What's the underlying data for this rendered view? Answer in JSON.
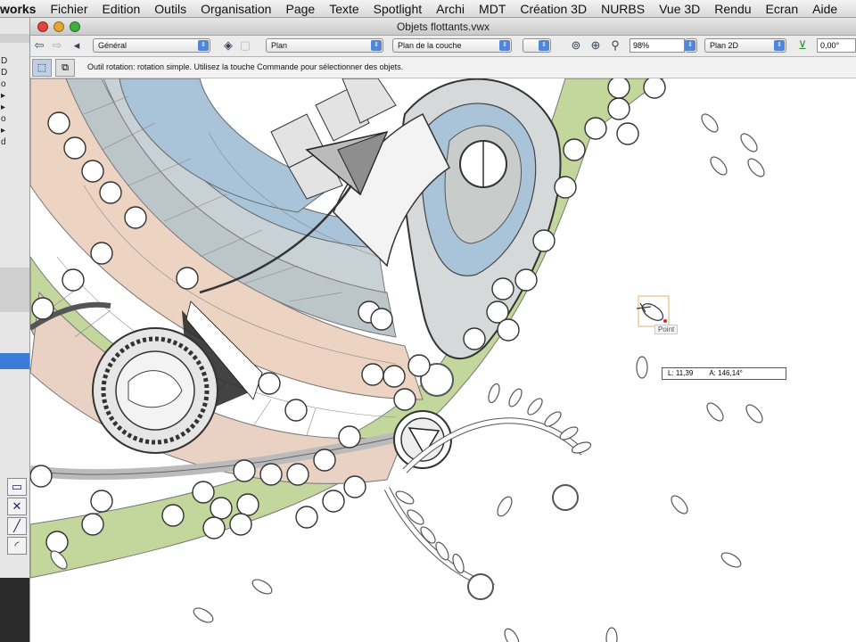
{
  "menubar": {
    "app_name": "works",
    "items": [
      "Fichier",
      "Edition",
      "Outils",
      "Organisation",
      "Page",
      "Texte",
      "Spotlight",
      "Archi",
      "MDT",
      "Création 3D",
      "NURBS",
      "Vue 3D",
      "Rendu",
      "Ecran",
      "Aide"
    ]
  },
  "window": {
    "title": "Objets flottants.vwx"
  },
  "toolbar": {
    "class_select": "Général",
    "layer_select": "Plan",
    "layer_plane_select": "Plan de la couche",
    "zoom_value": "98%",
    "view_select": "Plan 2D",
    "rotation_value": "0,00°"
  },
  "mode_bar": {
    "hint_text": "Outil rotation: rotation simple. Utilisez la touche Commande pour sélectionner des objets."
  },
  "canvas": {
    "snap_label": "Point",
    "readout_length": "L: 11,39",
    "readout_angle": "A: 146,14°"
  },
  "palette": {
    "rows": [
      "D",
      "D",
      "o",
      "▸",
      "▸",
      "o",
      "▸",
      "d"
    ]
  },
  "colors": {
    "water": "#a9c4d8",
    "lawn": "#c3d69b",
    "paving_pink": "#ecd3c2",
    "paving_grey": "#bcc5c8",
    "accent": "#4f86d9"
  }
}
